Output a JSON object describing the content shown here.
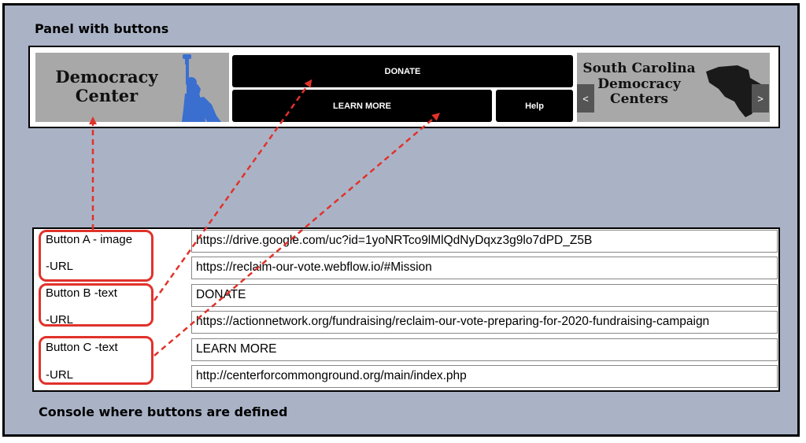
{
  "headings": {
    "panel": "Panel with buttons",
    "console": "Console where buttons are defined"
  },
  "panel": {
    "logo_left_lines": [
      "Democracy",
      "Center"
    ],
    "donate": "DONATE",
    "learn_more": "LEARN MORE",
    "help": "Help",
    "logo_right_lines": [
      "South Carolina",
      "Democracy",
      "Centers"
    ],
    "prev_arrow": "<",
    "next_arrow": ">"
  },
  "console": {
    "labels": [
      "Button A - image",
      "-URL",
      "Button B -text",
      "-URL",
      "Button C -text",
      "-URL"
    ],
    "fields": [
      "https://drive.google.com/uc?id=1yoNRTco9lMlQdNyDqxz3g9lo7dPD_Z5B",
      "https://reclaim-our-vote.webflow.io/#Mission",
      "DONATE",
      "https://actionnetwork.org/fundraising/reclaim-our-vote-preparing-for-2020-fundraising-campaign",
      "LEARN MORE",
      "http://centerforcommonground.org/main/index.php"
    ]
  },
  "colors": {
    "background": "#aab3c6",
    "annotation": "#e0322a",
    "statue": "#3a6fd0",
    "button": "#000000",
    "logo_bg": "#a8a8a8"
  },
  "icons": [
    "statue-of-liberty-icon",
    "south-carolina-map-icon"
  ]
}
